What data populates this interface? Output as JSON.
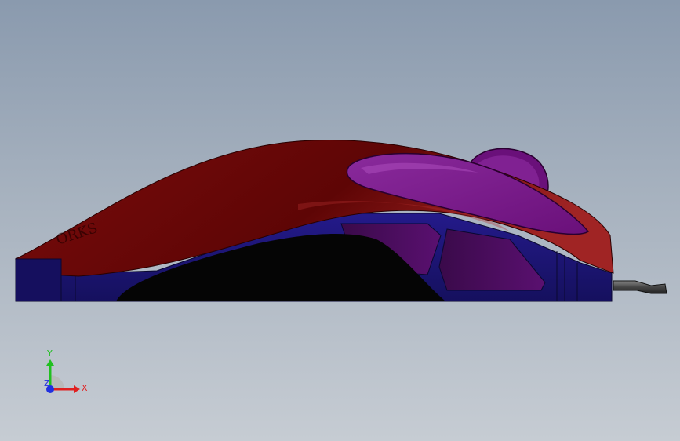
{
  "model": {
    "name": "mouse-3d-model",
    "logo_text": "ORKS",
    "colors": {
      "shell": "#6a0a0a",
      "shell_highlight": "#9a2020",
      "base": "#1a1170",
      "button": "#7a1a8a",
      "cavity": "#050505",
      "cable": "#555555"
    }
  },
  "triad": {
    "x_label": "X",
    "y_label": "Y",
    "z_label": "Z",
    "colors": {
      "x": "#e02020",
      "y": "#20c020",
      "z": "#2030e0"
    }
  }
}
